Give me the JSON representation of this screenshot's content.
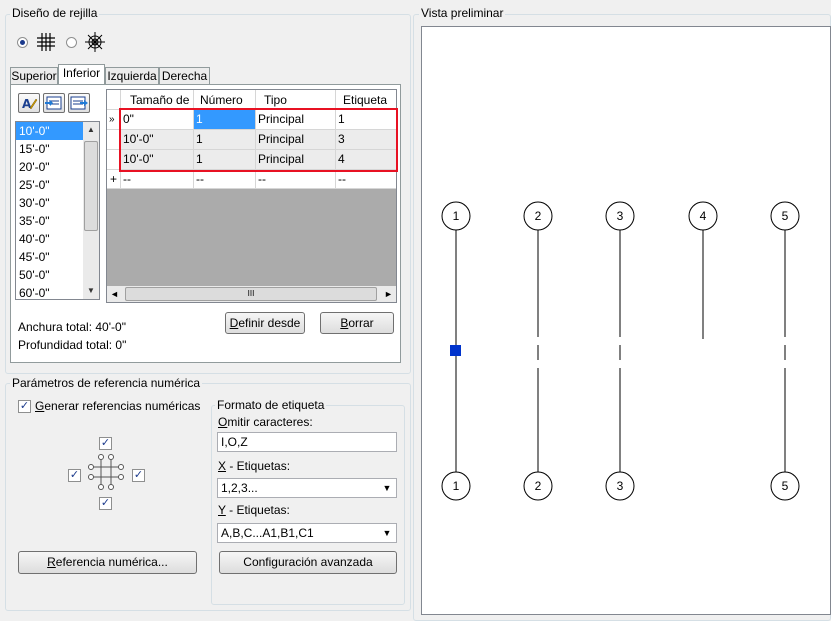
{
  "grid_layout": {
    "title": "Diseño de rejilla",
    "radio_orthogonal_icon": "grid-orthogonal-icon",
    "radio_radial_icon": "grid-radial-icon",
    "tabs": [
      "Superior",
      "Inferior",
      "Izquierda",
      "Derecha"
    ],
    "active_tab": "Inferior",
    "sizes": [
      "10'-0\"",
      "15'-0\"",
      "20'-0\"",
      "25'-0\"",
      "30'-0\"",
      "35'-0\"",
      "40'-0\"",
      "45'-0\"",
      "50'-0\"",
      "60'-0\""
    ],
    "selected_size": "10'-0\"",
    "columns": [
      "Tamaño de",
      "Número",
      "Tipo",
      "Etiqueta"
    ],
    "rows": [
      [
        "0\"",
        "1",
        "Principal",
        "1"
      ],
      [
        "10'-0\"",
        "1",
        "Principal",
        "3"
      ],
      [
        "10'-0\"",
        "1",
        "Principal",
        "4"
      ]
    ],
    "new_row_marker": "+",
    "new_row": [
      "--",
      "--",
      "--",
      "--"
    ],
    "row_marker": "»",
    "hscroll_grip": "III",
    "define_from_prefix": "",
    "define_from_underline": "D",
    "define_from_rest": "efinir desde",
    "delete_underline": "B",
    "delete_rest": "orrar",
    "total_width": "Anchura total: 40'-0\"",
    "total_depth": "Profundidad total: 0\""
  },
  "numbering": {
    "title": "Parámetros de referencia numérica",
    "generate_underline": "G",
    "generate_rest": "enerar referencias numéricas",
    "generate_checked": true,
    "num_button_underline": "R",
    "num_button_rest": "eferencia numérica...",
    "format_title": "Formato de etiqueta",
    "omit_underline": "O",
    "omit_rest": "mitir caracteres:",
    "omit_value": "I,O,Z",
    "x_underline": "X",
    "x_rest": " - Etiquetas:",
    "x_value": "1,2,3...",
    "y_underline": "Y",
    "y_rest": " - Etiquetas:",
    "y_value": "A,B,C...A1,B1,C1",
    "advanced_button": "Configuración avanzada"
  },
  "preview": {
    "title": "Vista preliminar",
    "top_labels": [
      "1",
      "2",
      "3",
      "4",
      "5"
    ],
    "bottom_labels": [
      "1",
      "2",
      "3",
      "5"
    ]
  }
}
